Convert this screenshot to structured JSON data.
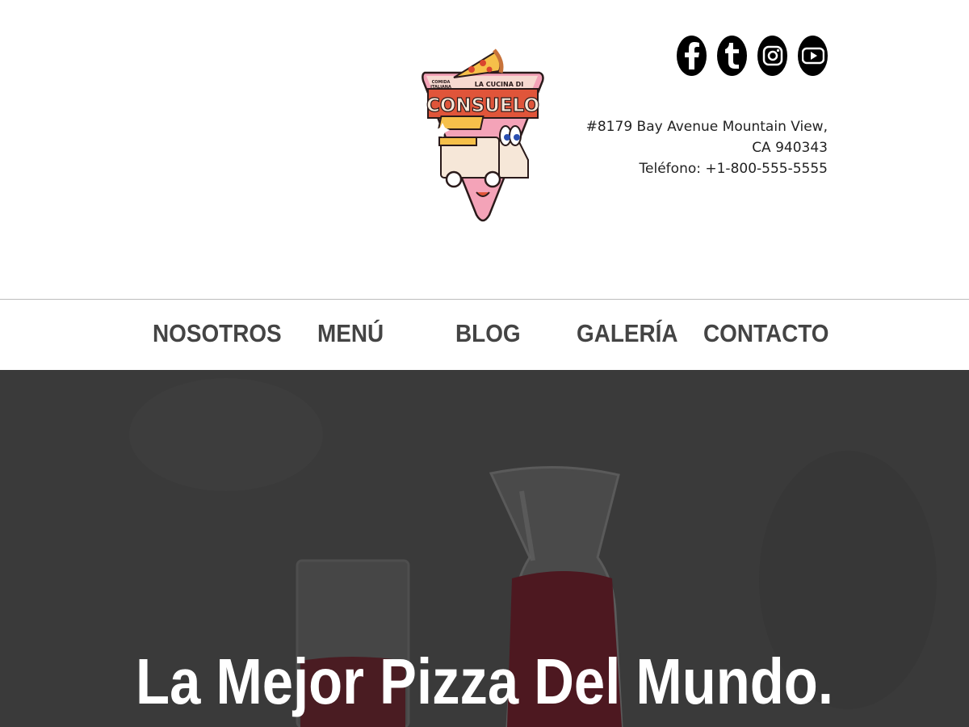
{
  "header": {
    "logo": {
      "alt": "La Cucina di Consuelo logo",
      "text_top": "LA CUCINA DI",
      "text_side": "COMIDA ITALIANA",
      "text_main": "CONSUELO"
    },
    "social": [
      {
        "name": "facebook-icon",
        "glyph": "f"
      },
      {
        "name": "tumblr-icon",
        "glyph": "t"
      },
      {
        "name": "instagram-icon",
        "glyph": ""
      },
      {
        "name": "youtube-icon",
        "glyph": ""
      }
    ],
    "address_line1": "#8179 Bay Avenue Mountain View,",
    "address_line2": "CA 940343",
    "phone": "Teléfono: +1-800-555-5555"
  },
  "nav": {
    "items": [
      "NOSOTROS",
      "MENÚ",
      "BLOG",
      "GALERÍA",
      "CONTACTO"
    ]
  },
  "hero": {
    "title": "La Mejor Pizza Del Mundo."
  },
  "colors": {
    "nav_text": "#444444",
    "hero_bg": "#3b3b3b",
    "logo_red": "#e0553a",
    "logo_pink": "#f4a3b8"
  }
}
